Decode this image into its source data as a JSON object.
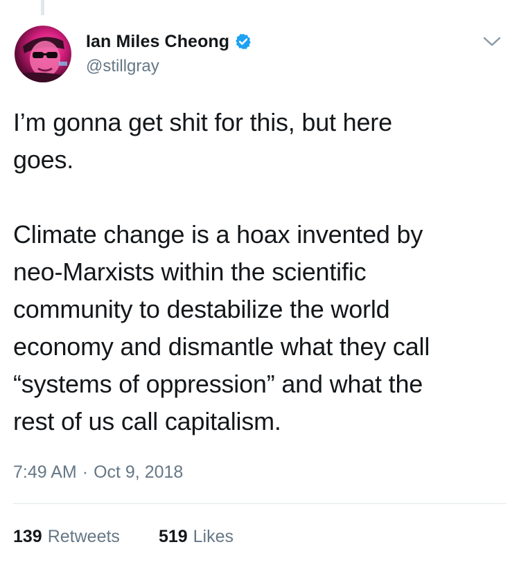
{
  "tweet": {
    "author": {
      "display_name": "Ian Miles Cheong",
      "handle": "@stillgray",
      "verified": true
    },
    "text": "I’m gonna get shit for this, but here\ngoes.\n\nClimate change is a hoax invented by\nneo-Marxists within the scientific\ncommunity to destabilize the world\neconomy and dismantle what they call\n“systems of oppression” and what the\nrest of us call capitalism.",
    "time": "7:49 AM",
    "separator": "·",
    "date": "Oct 9, 2018",
    "stats": {
      "retweets_count": "139",
      "retweets_label": "Retweets",
      "likes_count": "519",
      "likes_label": "Likes"
    }
  },
  "icons": {
    "verified": "verified-badge-icon",
    "menu": "chevron-down-icon"
  },
  "colors": {
    "text_primary": "#14171a",
    "text_secondary": "#657786",
    "verified_blue": "#1da1f2",
    "divider": "#e1e8ed"
  }
}
